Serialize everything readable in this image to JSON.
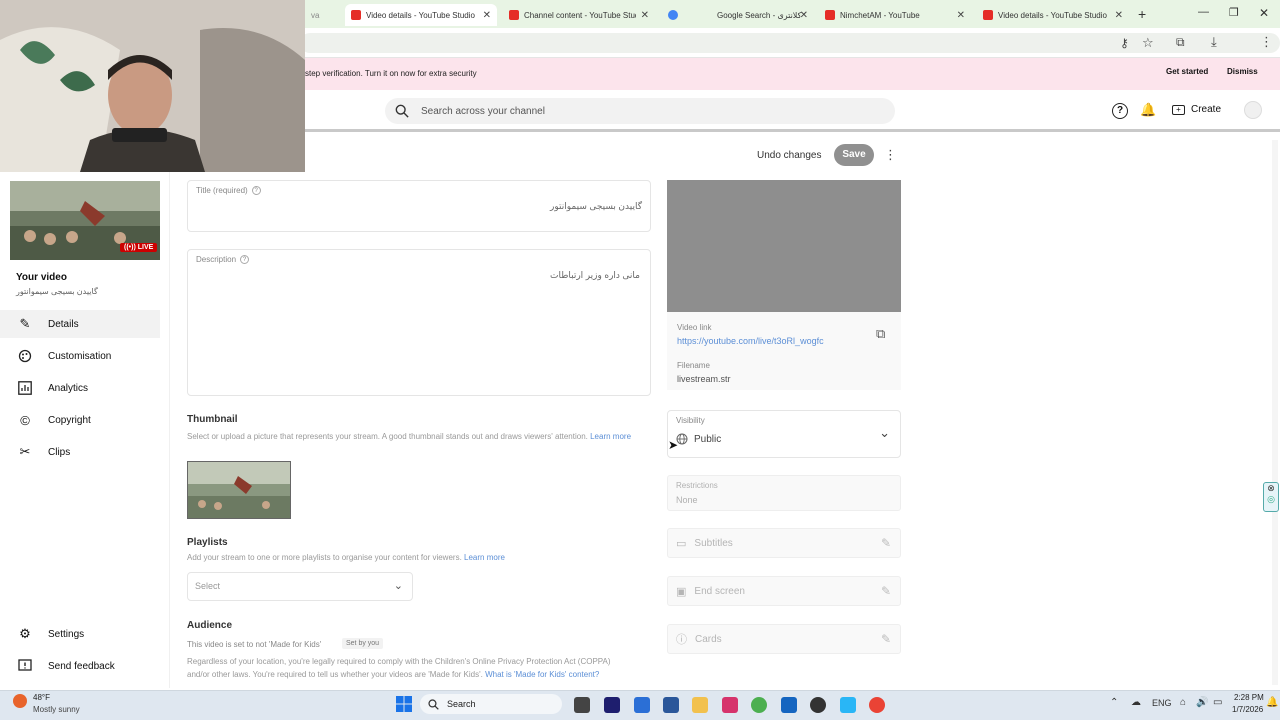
{
  "browser": {
    "tabs": [
      {
        "label": "Video details - YouTube Studio",
        "active": true
      },
      {
        "label": "Channel content - YouTube Studio"
      },
      {
        "label": "Google Search - کلانتری"
      },
      {
        "label": "NimchetAM - YouTube"
      },
      {
        "label": "Video details - YouTube Studio"
      }
    ],
    "partial_tab": "va"
  },
  "banner": {
    "text": "step verification. Turn it on now for extra security",
    "get_started": "Get started",
    "dismiss": "Dismiss"
  },
  "header": {
    "search_placeholder": "Search across your channel",
    "create_label": "Create"
  },
  "toolbar": {
    "undo_label": "Undo changes",
    "save_label": "Save"
  },
  "sidebar": {
    "live_badge": "LIVE",
    "your_video_label": "Your video",
    "video_title": "گاییدن بسیجی سیموانتور",
    "items": [
      {
        "label": "Details",
        "icon": "pencil-icon",
        "active": true
      },
      {
        "label": "Customisation",
        "icon": "customisation-icon"
      },
      {
        "label": "Analytics",
        "icon": "analytics-icon"
      },
      {
        "label": "Copyright",
        "icon": "copyright-icon"
      },
      {
        "label": "Clips",
        "icon": "scissors-icon"
      }
    ],
    "settings_label": "Settings",
    "feedback_label": "Send feedback"
  },
  "form": {
    "title_label": "Title (required)",
    "title_value": "گاییدن بسیجی سیموانتور",
    "description_label": "Description",
    "description_value": "مانی داره وزیر ارتباطات",
    "thumbnail_heading": "Thumbnail",
    "thumbnail_desc": "Select or upload a picture that represents your stream. A good thumbnail stands out and draws viewers' attention.",
    "thumbnail_learn_more": "Learn more",
    "playlists_heading": "Playlists",
    "playlists_desc": "Add your stream to one or more playlists to organise your content for viewers.",
    "playlists_learn_more": "Learn more",
    "playlist_select": "Select",
    "audience_heading": "Audience",
    "audience_status": "This video is set to not 'Made for Kids'",
    "audience_set_by": "Set by you",
    "audience_desc_1": "Regardless of your location, you're legally required to comply with the Children's Online Privacy Protection Act (COPPA)",
    "audience_desc_2": "and/or other laws. You're required to tell us whether your videos are 'Made for Kids'.",
    "audience_link": "What is 'Made for Kids' content?"
  },
  "right_panel": {
    "video_link_label": "Video link",
    "video_link": "https://youtube.com/live/t3oRl_wogfc",
    "filename_label": "Filename",
    "filename": "livestream.str",
    "visibility_label": "Visibility",
    "visibility_value": "Public",
    "restrictions_label": "Restrictions",
    "restrictions_value": "None",
    "subtitles_label": "Subtitles",
    "end_screen_label": "End screen",
    "cards_label": "Cards"
  },
  "taskbar": {
    "weather_temp": "48°F",
    "weather_desc": "Mostly sunny",
    "search_label": "Search",
    "lang": "ENG",
    "time": "2:28 PM",
    "date": "1/7/2026"
  }
}
